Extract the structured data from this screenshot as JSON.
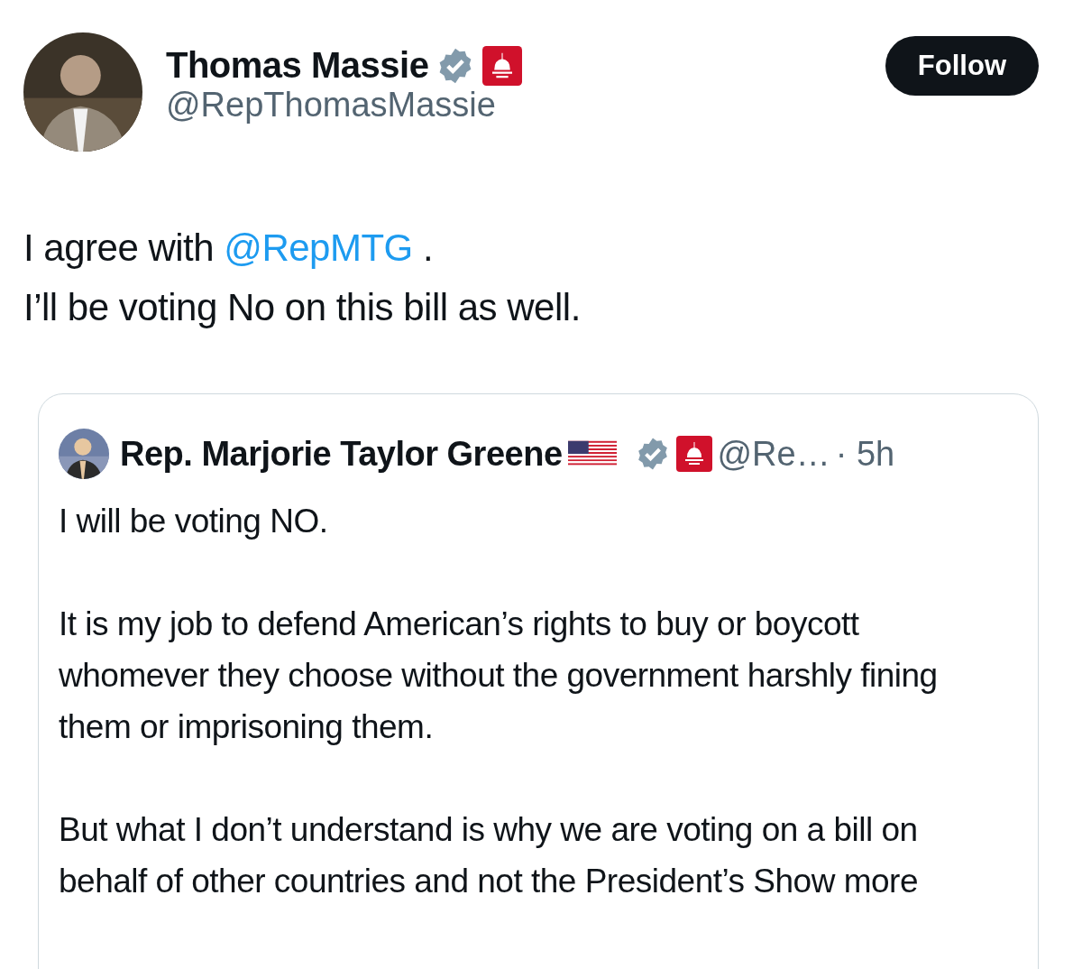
{
  "author": {
    "name": "Thomas Massie",
    "handle": "@RepThomasMassie",
    "verified": true
  },
  "follow_button": {
    "label": "Follow"
  },
  "body": [
    [
      {
        "kind": "text",
        "text": "I agree with "
      },
      {
        "kind": "mention",
        "text": "@RepMTG"
      },
      {
        "kind": "text",
        "text": " ."
      }
    ],
    [
      {
        "kind": "text",
        "text": "I’ll be voting No on this bill as well."
      }
    ]
  ],
  "quoted_post": {
    "name": "Rep. Marjorie Taylor Greene",
    "verified": true,
    "handle": "@Re…",
    "time": "· 5h",
    "paragraphs": [
      [
        {
          "kind": "text",
          "text": "I will be voting NO."
        }
      ],
      [
        {
          "kind": "text",
          "text": "It is my job to defend American’s rights to buy or boycott whomever they choose without the government harshly fining them or imprisoning them."
        }
      ],
      [
        {
          "kind": "text",
          "text": "But what I don’t understand is why we are voting on a bill on behalf of other countries and not the President’s "
        },
        {
          "kind": "more",
          "text": "Show more"
        }
      ]
    ]
  }
}
